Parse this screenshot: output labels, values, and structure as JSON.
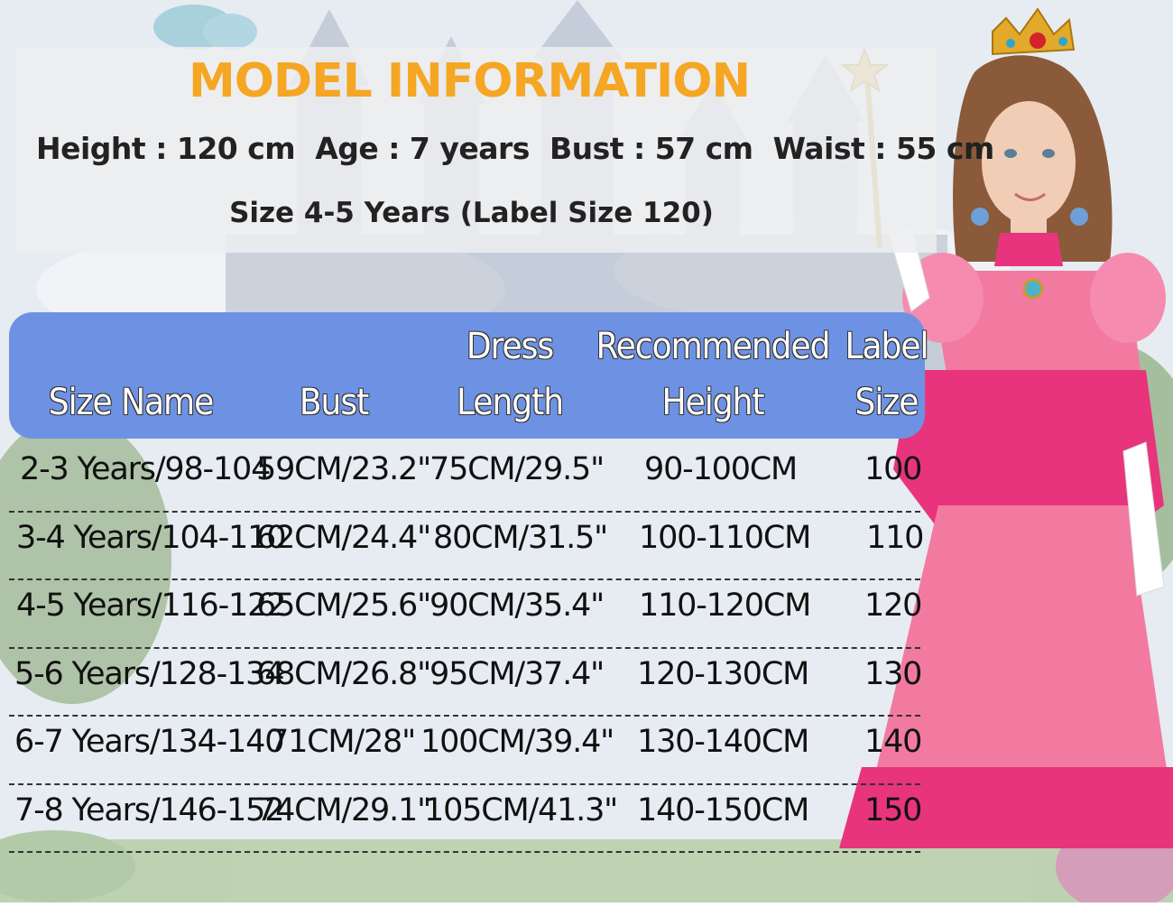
{
  "model": {
    "title": "MODEL INFORMATION",
    "height": "Height : 120 cm",
    "age": "Age : 7 years",
    "bust": "Bust : 57 cm",
    "waist": "Waist : 55 cm",
    "size": "Size 4-5 Years (Label Size 120)"
  },
  "table": {
    "headers": {
      "size_name": "Size Name",
      "bust": "Bust",
      "dress_line1": "Dress",
      "dress_line2": "Length",
      "height_line1": "Recommended",
      "height_line2": "Height",
      "label_line1": "Label",
      "label_line2": "Size"
    },
    "rows": [
      {
        "size": "2-3 Years/98-104",
        "bust": "59CM/23.2\"",
        "length": "75CM/29.5\"",
        "height": "90-100CM",
        "label": "100"
      },
      {
        "size": "3-4 Years/104-110",
        "bust": "62CM/24.4\"",
        "length": "80CM/31.5\"",
        "height": "100-110CM",
        "label": "110"
      },
      {
        "size": "4-5 Years/116-122",
        "bust": "65CM/25.6\"",
        "length": "90CM/35.4\"",
        "height": "110-120CM",
        "label": "120"
      },
      {
        "size": "5-6 Years/128-134",
        "bust": "68CM/26.8\"",
        "length": "95CM/37.4\"",
        "height": "120-130CM",
        "label": "130"
      },
      {
        "size": "6-7 Years/134-140",
        "bust": "71CM/28\"",
        "length": "100CM/39.4\"",
        "height": "130-140CM",
        "label": "140"
      },
      {
        "size": "7-8 Years/146-152",
        "bust": "74CM/29.1\"",
        "length": "105CM/41.3\"",
        "height": "140-150CM",
        "label": "150"
      }
    ]
  },
  "colors": {
    "title_orange": "#f5a623",
    "header_blue": "#6e92e3",
    "dress_pink": "#f27aa0",
    "dress_magenta": "#e8347c"
  }
}
